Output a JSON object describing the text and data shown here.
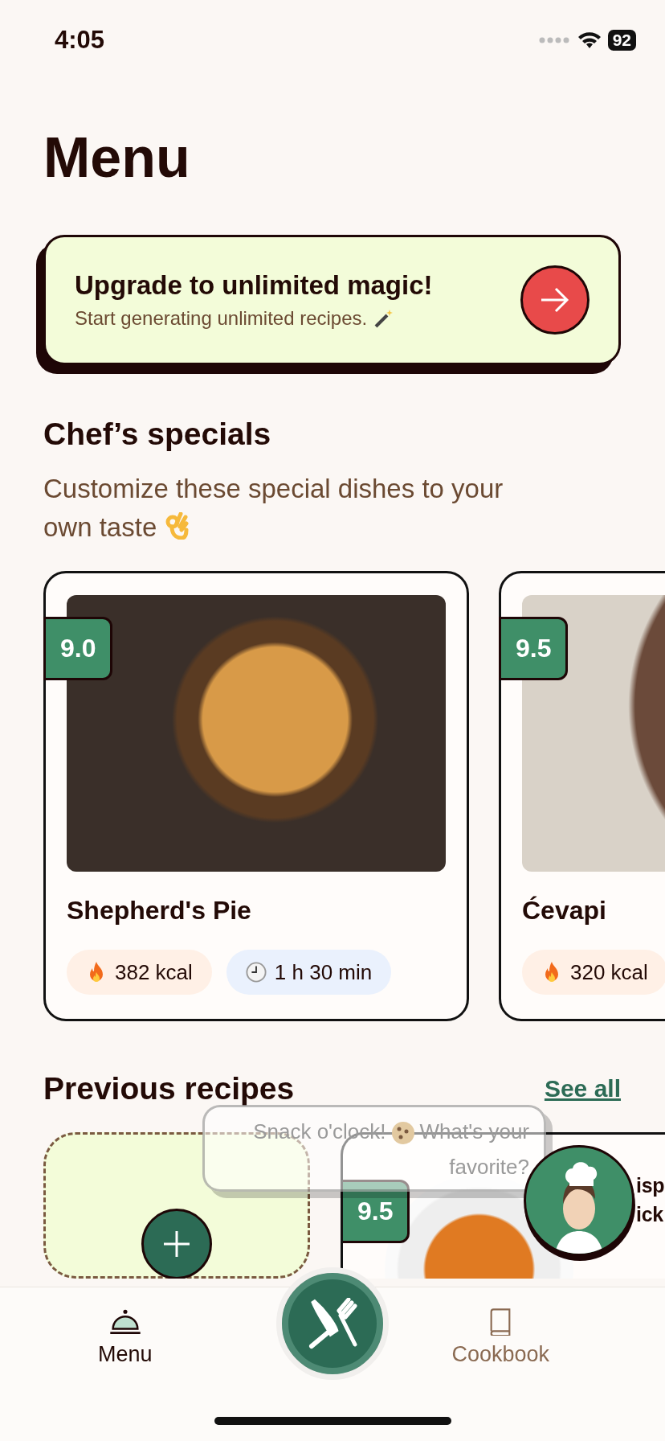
{
  "status_bar": {
    "time": "4:05",
    "battery": "92"
  },
  "title": "Menu",
  "promo": {
    "title": "Upgrade to unlimited magic!",
    "subtitle": "Start generating unlimited recipes."
  },
  "specials": {
    "heading": "Chef’s specials",
    "subtitle_lines": [
      "Customize these special dishes to your",
      "own taste"
    ],
    "cards": [
      {
        "score": "9.0",
        "name": "Shepherd's Pie",
        "chips": [
          {
            "kind": "calories",
            "text": "382 kcal"
          },
          {
            "kind": "time",
            "text": "1 h 30 min"
          }
        ]
      },
      {
        "score": "9.5",
        "name": "Ćevapi",
        "chips": [
          {
            "kind": "calories",
            "text": "320 kcal"
          }
        ]
      }
    ]
  },
  "previous": {
    "heading": "Previous recipes",
    "see_all": "See all",
    "recipes": [
      {
        "score": "9.5",
        "title_lines": [
          "isp",
          "ick"
        ]
      }
    ]
  },
  "chat_bubble": {
    "before": "Snack o'clock!",
    "after": "What's your favorite?"
  },
  "nav": {
    "tabs": [
      {
        "label": "Menu",
        "selected": true
      },
      {
        "label": "Cookbook",
        "selected": false
      }
    ]
  }
}
